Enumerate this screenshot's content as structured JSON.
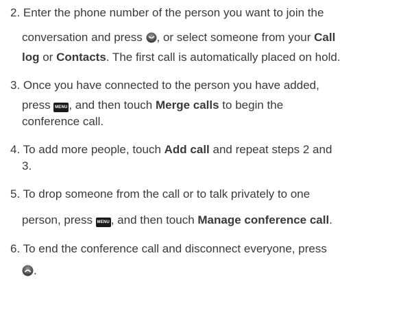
{
  "steps": [
    {
      "number": "2.",
      "lines": [
        "Enter the phone number of the person you want to join the",
        "conversation and press",
        ", or select someone from your ",
        "Call",
        "log",
        " or ",
        "Contacts",
        ". The first call is automatically placed on hold."
      ]
    },
    {
      "number": "3.",
      "lines": [
        "Once you have connected to the person you have added,",
        "press",
        ", and then touch ",
        "Merge calls",
        " to begin the",
        "conference call."
      ]
    },
    {
      "number": "4.",
      "lines": [
        "To add more people, touch ",
        "Add call",
        " and repeat steps 2 and",
        "3."
      ]
    },
    {
      "number": "5.",
      "lines": [
        "To drop someone from the call or to talk privately to one",
        "person, press",
        ", and then touch ",
        "Manage conference call",
        "."
      ]
    },
    {
      "number": "6.",
      "lines": [
        "To end the conference call and disconnect everyone, press",
        "."
      ]
    }
  ],
  "icons": {
    "send_key": "send-key-icon",
    "menu_key": "menu-key-icon",
    "menu_key_label": "MENU",
    "end_key": "end-key-icon"
  }
}
